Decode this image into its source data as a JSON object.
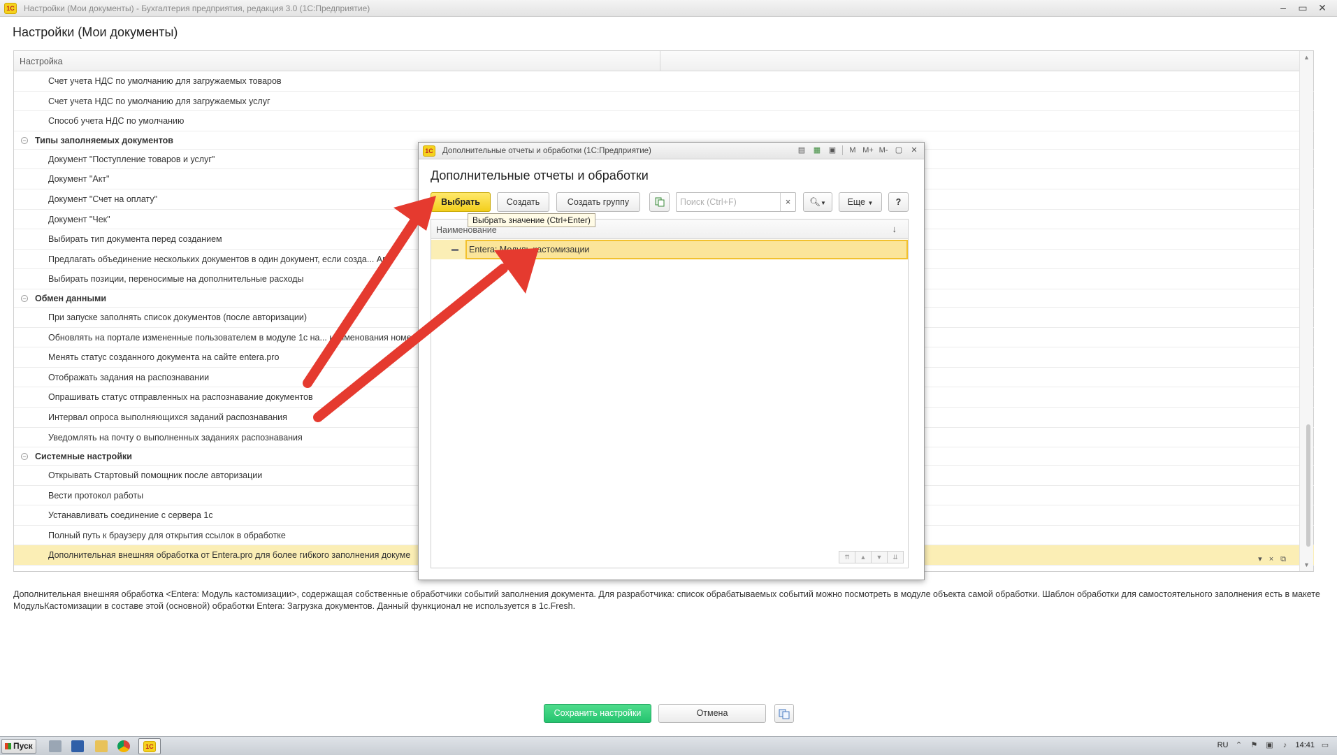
{
  "window": {
    "title": "Настройки (Мои документы) - Бухгалтерия предприятия, редакция 3.0  (1С:Предприятие)",
    "logo": "1С",
    "page_title": "Настройки (Мои документы)"
  },
  "tree": {
    "column_header": "Настройка",
    "rows": [
      {
        "type": "item",
        "label": "Счет учета НДС по умолчанию для загружаемых товаров"
      },
      {
        "type": "item",
        "label": "Счет учета НДС по умолчанию для загружаемых услуг"
      },
      {
        "type": "item",
        "label": "Способ учета НДС по умолчанию"
      },
      {
        "type": "group",
        "label": "Типы заполняемых документов"
      },
      {
        "type": "item",
        "label": "Документ \"Поступление товаров и услуг\""
      },
      {
        "type": "item",
        "label": "Документ \"Акт\""
      },
      {
        "type": "item",
        "label": "Документ \"Счет на оплату\""
      },
      {
        "type": "item",
        "label": "Документ \"Чек\""
      },
      {
        "type": "item",
        "label": "Выбирать тип документа перед созданием"
      },
      {
        "type": "item",
        "label": "Предлагать объединение нескольких документов в один документ, если созда... Ава"
      },
      {
        "type": "item",
        "label": "Выбирать позиции, переносимые на дополнительные расходы"
      },
      {
        "type": "group",
        "label": "Обмен данными"
      },
      {
        "type": "item",
        "label": "При запуске заполнять список документов (после авторизации)"
      },
      {
        "type": "item",
        "label": "Обновлять на портале измененные пользователем в модуле 1с на... наименования номен"
      },
      {
        "type": "item",
        "label": "Менять статус созданного документа на сайте entera.pro"
      },
      {
        "type": "item",
        "label": "Отображать задания на распознавании"
      },
      {
        "type": "item",
        "label": "Опрашивать статус отправленных на распознавание документов"
      },
      {
        "type": "item",
        "label": "Интервал опроса выполняющихся заданий распознавания"
      },
      {
        "type": "item",
        "label": "Уведомлять на почту о выполненных заданиях распознавания"
      },
      {
        "type": "group",
        "label": "Системные настройки"
      },
      {
        "type": "item",
        "label": "Открывать Стартовый помощник после авторизации"
      },
      {
        "type": "item",
        "label": "Вести протокол работы"
      },
      {
        "type": "item",
        "label": "Устанавливать соединение с сервера 1с"
      },
      {
        "type": "item",
        "label": "Полный путь к браузеру для открытия ссылок в обработке"
      },
      {
        "type": "item",
        "label": "Дополнительная внешняя обработка от Entera.pro для более гибкого заполнения докуме",
        "selected": true
      }
    ]
  },
  "description": "Дополнительная внешняя обработка <Entera: Модуль кастомизации>, содержащая собственные обработчики событий заполнения документа. Для разработчика: список обрабатываемых событий можно посмотреть в модуле объекта самой обработки. Шаблон обработки для самостоятельного заполнения есть в макете МодульКастомизации в составе этой (основной) обработки Entera: Загрузка документов. Данный функционал не используется в 1c.Fresh.",
  "footer": {
    "save_label": "Сохранить настройки",
    "cancel_label": "Отмена"
  },
  "modal": {
    "title": "Дополнительные отчеты и обработки  (1С:Предприятие)",
    "heading": "Дополнительные отчеты и обработки",
    "tools": [
      "M",
      "M+",
      "M-"
    ],
    "select_label": "Выбрать",
    "create_label": "Создать",
    "create_group_label": "Создать группу",
    "search_placeholder": "Поиск (Ctrl+F)",
    "more_label": "Еще",
    "help_label": "?",
    "tooltip": "Выбрать значение (Ctrl+Enter)",
    "list_header": "Наименование",
    "list_rows": [
      {
        "label": "Entera: Модуль кастомизации"
      }
    ]
  },
  "taskbar": {
    "start_label": "Пуск",
    "lang": "RU",
    "time": "14:41"
  },
  "colors": {
    "accent_yellow": "#f3cf1c",
    "selection": "#fbeeb5",
    "save_green": "#25c46f",
    "arrow_red": "#e53a2f"
  }
}
